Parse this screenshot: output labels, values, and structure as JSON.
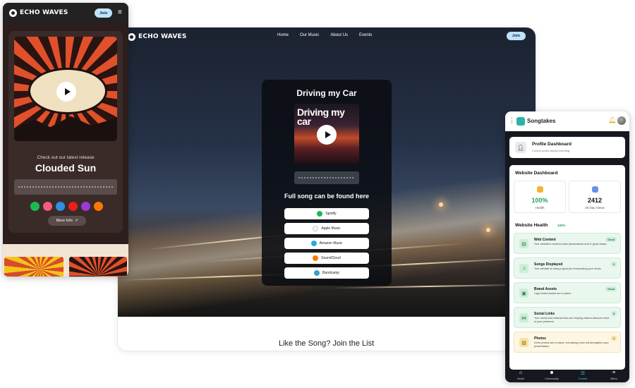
{
  "brand": {
    "name": "ECHO WAVES",
    "join_label": "Join"
  },
  "desktop": {
    "nav": [
      "Home",
      "Our Music",
      "About Us",
      "Events"
    ],
    "player": {
      "song_title": "Driving my Car",
      "cover_text": "Driving my car",
      "full_song_text": "Full song can be found here",
      "services": [
        {
          "label": "Spotify",
          "color": "#1db954"
        },
        {
          "label": "Apple Music",
          "color": "#f5f5f5"
        },
        {
          "label": "Amazon Music",
          "color": "#25a8e0"
        },
        {
          "label": "SoundCloud",
          "color": "#ff7700"
        },
        {
          "label": "Bandcamp",
          "color": "#3aa0c8"
        }
      ]
    },
    "below_title": "Like the Song? Join the List"
  },
  "mobile_site": {
    "subtitle": "Check out our latest release",
    "title": "Clouded Sun",
    "more_info_label": "More Info",
    "social_icons": [
      {
        "name": "spotify-icon",
        "color": "#1db954"
      },
      {
        "name": "apple-music-icon",
        "color": "#f35d7a"
      },
      {
        "name": "amazon-music-icon",
        "color": "#2f8fe0"
      },
      {
        "name": "youtube-icon",
        "color": "#e62117"
      },
      {
        "name": "bandcamp-icon",
        "color": "#9b38d6"
      },
      {
        "name": "soundcloud-icon",
        "color": "#ff7700"
      }
    ]
  },
  "dashboard": {
    "app_name": "Songtakes",
    "profile": {
      "title": "Profile Dashboard",
      "subtitle": "Control public-facing branding."
    },
    "website_dashboard_title": "Website Dashboard",
    "stats": [
      {
        "value": "100%",
        "label": "Health",
        "color": "#22a35a",
        "icon_color": "#f2b233"
      },
      {
        "value": "2412",
        "label": "30 Day Views",
        "color": "#111111",
        "icon_color": "#6b8fe8"
      }
    ],
    "health_title": "Website Health",
    "health_pct": "100%",
    "health_items": [
      {
        "title": "Web Content",
        "desc": "Your website's content looks personalized and in good shape.",
        "badge": "Good",
        "icon": "▤",
        "warn": false
      },
      {
        "title": "Songs Displayed",
        "desc": "Your website is doing a good job showcasing your music.",
        "badge": "5",
        "icon": "♫",
        "warn": false
      },
      {
        "title": "Brand Assets",
        "desc": "Logo brand assets are in place.",
        "badge": "Good",
        "icon": "▣",
        "warn": false
      },
      {
        "title": "Social Links",
        "desc": "Your social and external links are helping visitors discover more of your presence.",
        "badge": "8",
        "icon": "⋈",
        "warn": false
      },
      {
        "title": "Photos",
        "desc": "A few photos are in place, but adding more will strengthen your presentation.",
        "badge": "4",
        "icon": "▧",
        "warn": true
      }
    ],
    "tabs": [
      {
        "label": "Home",
        "icon": "⌂",
        "active": false
      },
      {
        "label": "Community",
        "icon": "☻",
        "active": false
      },
      {
        "label": "Control",
        "icon": "☰",
        "active": true
      },
      {
        "label": "Menu",
        "icon": "≡",
        "active": false
      }
    ]
  }
}
